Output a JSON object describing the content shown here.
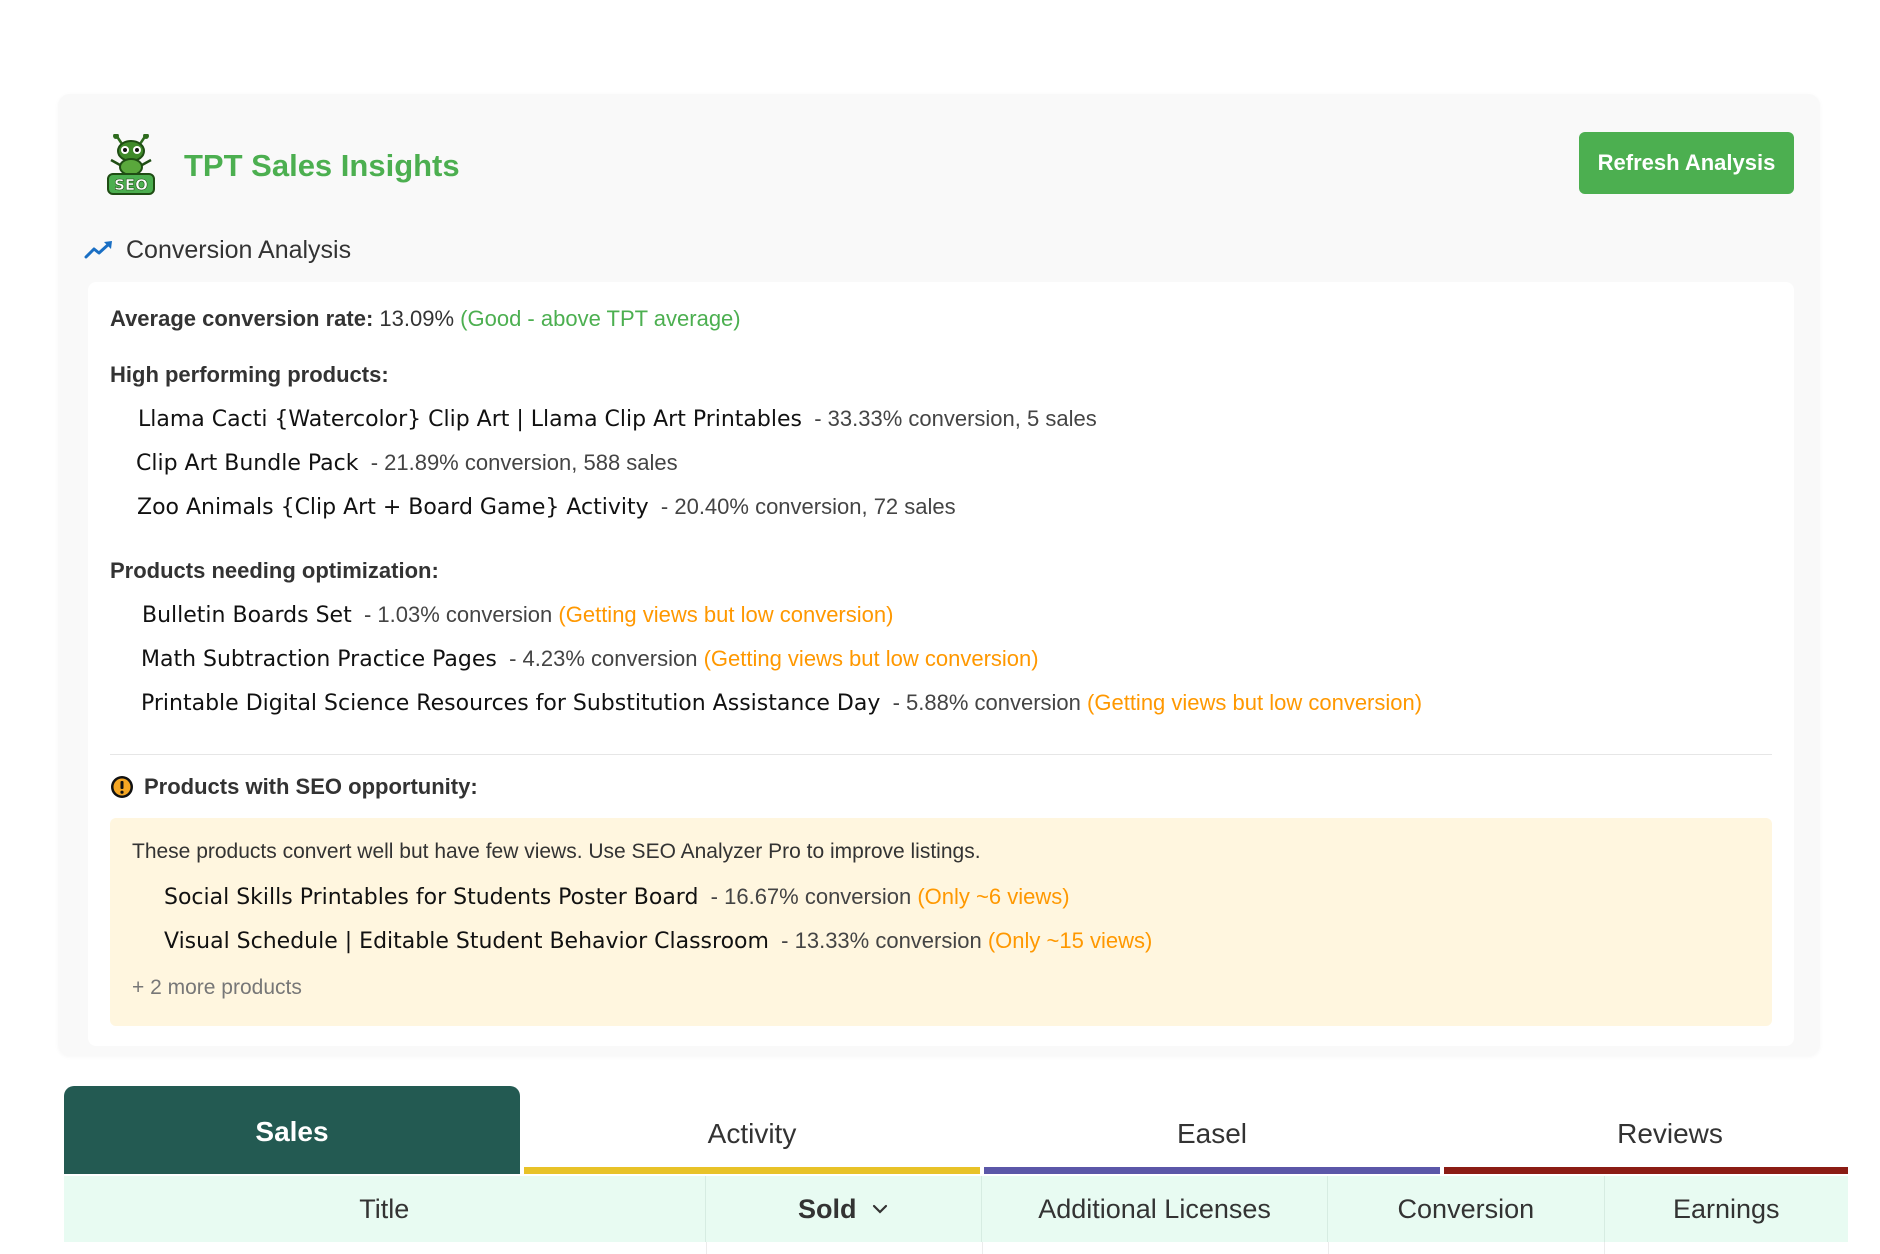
{
  "header": {
    "logo_text": "SEO",
    "title": "TPT Sales Insights",
    "refresh_label": "Refresh Analysis"
  },
  "conversion": {
    "heading": "Conversion Analysis",
    "average_label": "Average conversion rate:",
    "average_value": "13.09%",
    "average_note": "(Good - above TPT average)",
    "high_label": "High performing products:",
    "high_products": [
      {
        "title": "Llama Cacti {Watercolor} Clip Art | Llama Clip Art Printables",
        "meta": "- 33.33% conversion, 5 sales"
      },
      {
        "title": "Clip Art Bundle Pack",
        "meta": "- 21.89% conversion, 588 sales"
      },
      {
        "title": "Zoo Animals {Clip Art + Board Game} Activity",
        "meta": "- 20.40% conversion, 72 sales"
      }
    ],
    "opt_label": "Products needing optimization:",
    "opt_products": [
      {
        "title": "Bulletin Boards Set",
        "meta": "- 1.03% conversion",
        "note": "(Getting views but low conversion)"
      },
      {
        "title": "Math Subtraction Practice Pages",
        "meta": "- 4.23% conversion",
        "note": "(Getting views but low conversion)"
      },
      {
        "title": "Printable Digital Science Resources for Substitution Assistance Day",
        "meta": "- 5.88% conversion",
        "note": "(Getting views but low conversion)"
      }
    ],
    "seo_label": "Products with SEO opportunity:",
    "seo_intro": "These products convert well but have few views. Use SEO Analyzer Pro to improve listings.",
    "seo_products": [
      {
        "title": "Social Skills Printables for Students Poster Board",
        "meta": "- 16.67% conversion",
        "note": "(Only ~6 views)"
      },
      {
        "title": "Visual Schedule | Editable Student Behavior Classroom",
        "meta": "- 13.33% conversion",
        "note": "(Only ~15 views)"
      }
    ],
    "seo_more": "+ 2 more products"
  },
  "tabs": [
    {
      "label": "Sales",
      "color": "#235a52"
    },
    {
      "label": "Activity",
      "color": "#e8c228"
    },
    {
      "label": "Easel",
      "color": "#5b57a8"
    },
    {
      "label": "Reviews",
      "color": "#8b1c14"
    }
  ],
  "table": {
    "columns": [
      "Title",
      "Sold",
      "Additional Licenses",
      "Conversion",
      "Earnings"
    ]
  },
  "colors": {
    "accent_green": "#4caf50",
    "warning_orange": "#ff9800",
    "tab_active": "#235a52",
    "seo_box_bg": "#fff6df",
    "table_header_bg": "#e8fbf2"
  }
}
